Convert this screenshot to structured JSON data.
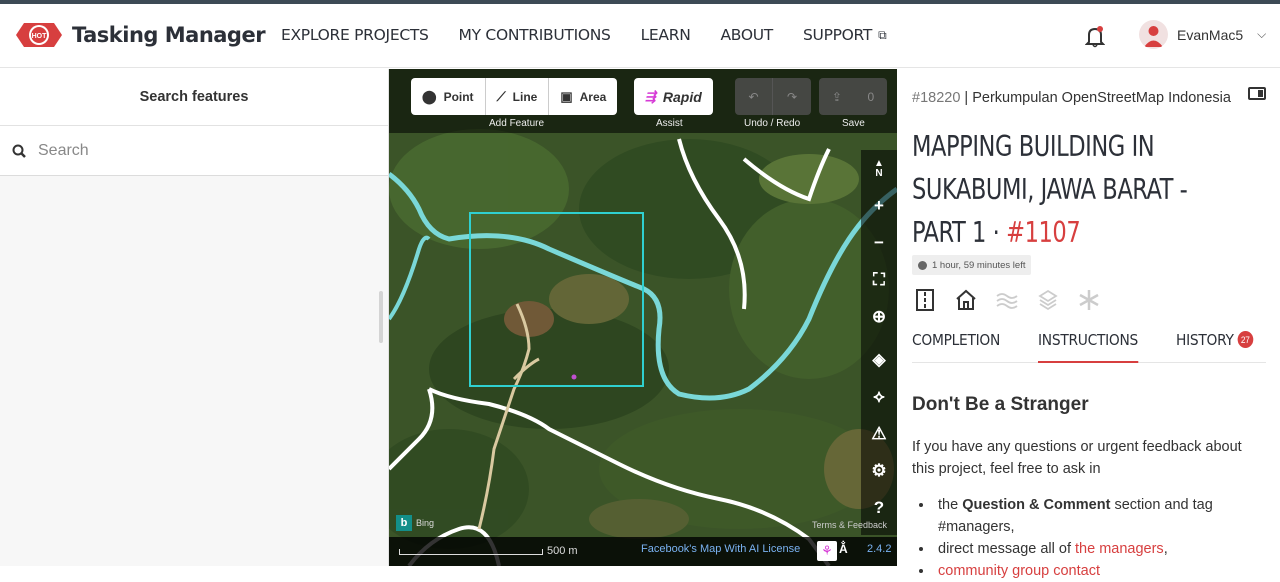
{
  "header": {
    "app_name": "Tasking Manager",
    "logo_text": "HOT",
    "nav": [
      "EXPLORE PROJECTS",
      "MY CONTRIBUTIONS",
      "LEARN",
      "ABOUT",
      "SUPPORT"
    ],
    "username": "EvanMac5"
  },
  "left_panel": {
    "title": "Search features",
    "search_placeholder": "Search"
  },
  "map": {
    "toolbar": {
      "point": "Point",
      "line": "Line",
      "area": "Area",
      "add_feature": "Add Feature",
      "rapid": "Rapid",
      "assist": "Assist",
      "undo_redo": "Undo / Redo",
      "save": "Save",
      "save_count": "0"
    },
    "controls": [
      "N",
      "+",
      "−"
    ],
    "footer": {
      "scale": "500 m",
      "attribution": "Facebook's Map With AI License",
      "version": "2.4.2"
    },
    "bing": "Bing",
    "terms": "Terms & Feedback"
  },
  "project": {
    "id": "#18220",
    "org": "Perkumpulan OpenStreetMap Indonesia",
    "title": "MAPPING BUILDING IN SUKABUMI, JAWA BARAT - PART 1 · ",
    "task_number": "#1107",
    "time_left": "1 hour, 59 minutes left",
    "tabs": [
      {
        "label": "COMPLETION"
      },
      {
        "label": "INSTRUCTIONS"
      },
      {
        "label": "HISTORY",
        "badge": "27"
      }
    ],
    "instructions": {
      "heading": "Don't Be a Stranger",
      "intro": "If you have any questions or urgent feedback about this project, feel free to ask in",
      "bullet1_pre": "the ",
      "bullet1_bold": "Question & Comment",
      "bullet1_post": " section and tag #managers,",
      "bullet2_pre": "direct message all of ",
      "bullet2_link": "the managers",
      "bullet2_post": ",",
      "bullet3_link": "community group contact"
    }
  },
  "colors": {
    "accent": "#d73f3f",
    "task_outline": "#2fd0d0",
    "river": "#7ad8d8"
  }
}
